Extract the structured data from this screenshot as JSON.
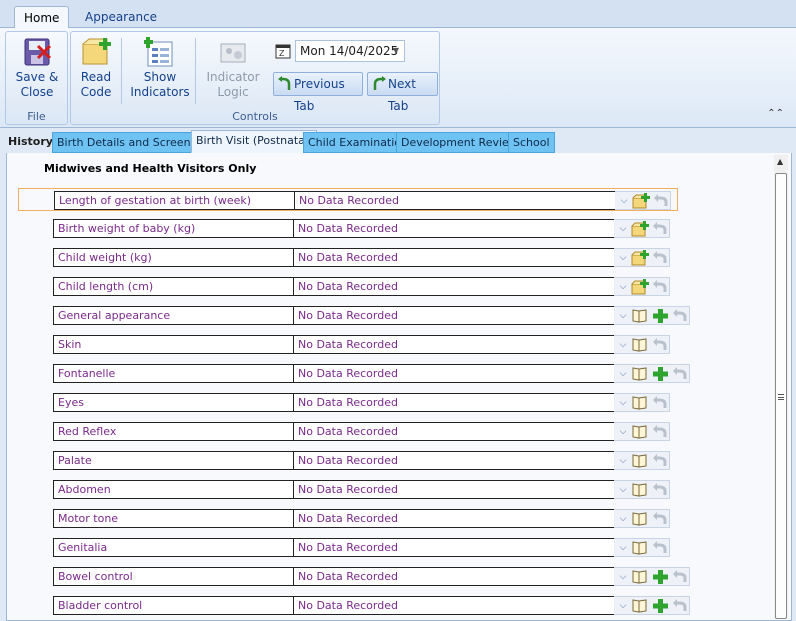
{
  "ribbon": {
    "tabs": [
      {
        "label": "Home"
      },
      {
        "label": "Appearance"
      }
    ],
    "groups": {
      "file": {
        "label": "File",
        "save_close_line1": "Save &",
        "save_close_line2": "Close"
      },
      "controls": {
        "label": "Controls",
        "read_code_line1": "Read",
        "read_code_line2": "Code",
        "show_indicators_line1": "Show",
        "show_indicators_line2": "Indicators",
        "indicator_logic_line1": "Indicator",
        "indicator_logic_line2": "Logic",
        "date": "Mon 14/04/2025",
        "previous_tab": "Previous Tab",
        "next_tab": "Next Tab"
      }
    }
  },
  "history": {
    "label": "History",
    "tabs": [
      {
        "label": "Birth Details and Screening"
      },
      {
        "label": "Birth Visit (Postnatal)"
      },
      {
        "label": "Child Examination"
      },
      {
        "label": "Development Review"
      },
      {
        "label": "School"
      }
    ],
    "active_tab": "Birth Visit (Postnatal)"
  },
  "section": {
    "title": "Midwives and Health Visitors Only",
    "rows": [
      {
        "label": "Length of gestation at birth (week)",
        "value": "No Data Recorded",
        "tools": "measure"
      },
      {
        "label": "Birth weight of baby (kg)",
        "value": "No Data Recorded",
        "tools": "measure"
      },
      {
        "label": "Child weight (kg)",
        "value": "No Data Recorded",
        "tools": "measure"
      },
      {
        "label": "Child length (cm)",
        "value": "No Data Recorded",
        "tools": "measure"
      },
      {
        "label": "General appearance",
        "value": "No Data Recorded",
        "tools": "book-plus"
      },
      {
        "label": "Skin",
        "value": "No Data Recorded",
        "tools": "book"
      },
      {
        "label": "Fontanelle",
        "value": "No Data Recorded",
        "tools": "book-plus"
      },
      {
        "label": "Eyes",
        "value": "No Data Recorded",
        "tools": "book"
      },
      {
        "label": "Red Reflex",
        "value": "No Data Recorded",
        "tools": "book"
      },
      {
        "label": "Palate",
        "value": "No Data Recorded",
        "tools": "book"
      },
      {
        "label": "Abdomen",
        "value": "No Data Recorded",
        "tools": "book"
      },
      {
        "label": "Motor tone",
        "value": "No Data Recorded",
        "tools": "book"
      },
      {
        "label": "Genitalia",
        "value": "No Data Recorded",
        "tools": "book"
      },
      {
        "label": "Bowel control",
        "value": "No Data Recorded",
        "tools": "book-plus"
      },
      {
        "label": "Bladder control",
        "value": "No Data Recorded",
        "tools": "book-plus"
      }
    ]
  },
  "icons": {
    "save": "save-close-icon",
    "read_code": "read-code-icon",
    "show_indicators": "show-indicators-icon",
    "indicator_logic": "indicator-logic-icon",
    "calendar": "calendar-icon",
    "previous": "previous-tab-icon",
    "next": "next-tab-icon",
    "expand": "chevron-down-icon",
    "add_value": "add-value-icon",
    "picklist": "picklist-book-icon",
    "add": "plus-icon",
    "undo": "undo-icon"
  },
  "colors": {
    "history_tab": "#6ec3f2",
    "row_text": "#7a2a8a",
    "selected_border": "#f0b060"
  }
}
